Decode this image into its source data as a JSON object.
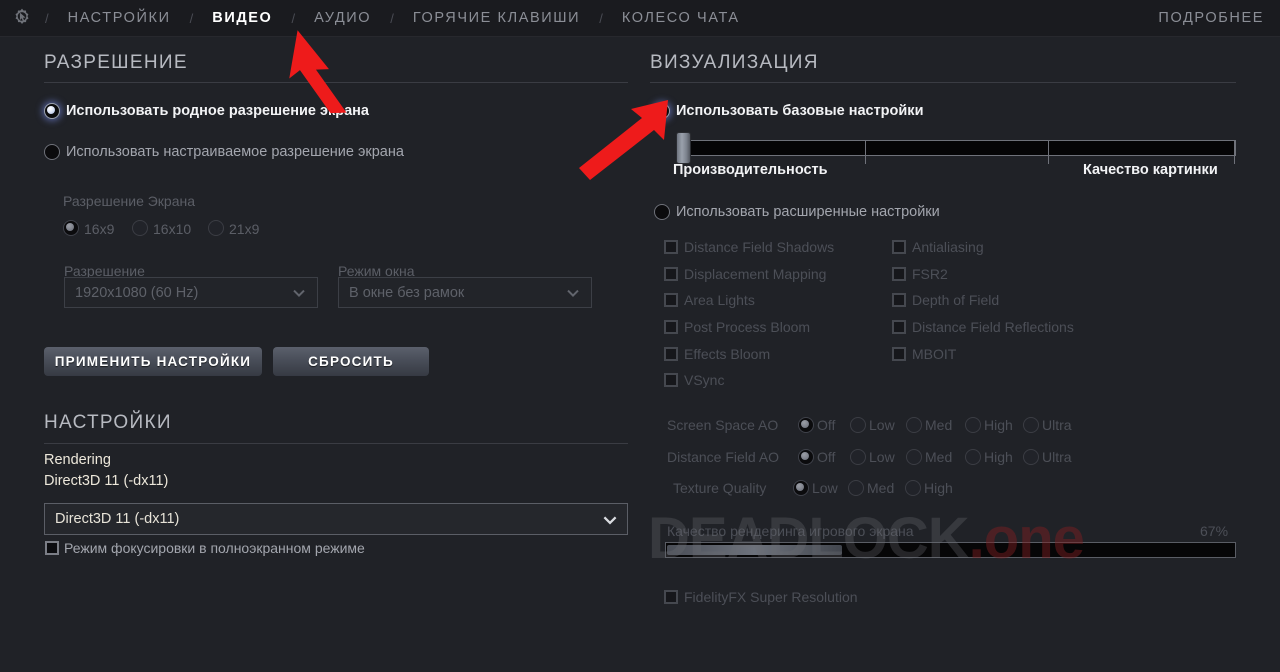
{
  "nav": {
    "gear_icon": "gear-cursor-icon",
    "separator": "/",
    "items": [
      {
        "label": "НАСТРОЙКИ",
        "active": false
      },
      {
        "label": "ВИДЕО",
        "active": true
      },
      {
        "label": "АУДИО",
        "active": false
      },
      {
        "label": "ГОРЯЧИЕ КЛАВИШИ",
        "active": false
      },
      {
        "label": "КОЛЕСО ЧАТА",
        "active": false
      }
    ],
    "more_label": "ПОДРОБНЕЕ"
  },
  "left": {
    "resolution_section": {
      "title": "РАЗРЕШЕНИЕ",
      "radio_native": {
        "label": "Использовать родное разрешение экрана",
        "selected": true
      },
      "radio_custom": {
        "label": "Использовать настраиваемое разрешение экрана",
        "selected": false
      },
      "aspect_label": "Разрешение Экрана",
      "aspect_options": [
        {
          "label": "16x9",
          "selected": true
        },
        {
          "label": "16x10",
          "selected": false
        },
        {
          "label": "21x9",
          "selected": false
        }
      ],
      "resolution_field_label": "Разрешение",
      "resolution_value": "1920x1080 (60 Hz)",
      "window_mode_label": "Режим окна",
      "window_mode_value": "В окне без рамок",
      "apply_button": "ПРИМЕНИТЬ НАСТРОЙКИ",
      "reset_button": "СБРОСИТЬ"
    },
    "settings_section": {
      "title": "НАСТРОЙКИ",
      "rendering_label": "Rendering",
      "rendering_sub": "Direct3D 11 (-dx11)",
      "renderer_value": "Direct3D 11 (-dx11)",
      "focus_mode": {
        "label": "Режим фокусировки в полноэкранном режиме",
        "checked": false
      }
    }
  },
  "right": {
    "visual_section": {
      "title": "ВИЗУАЛИЗАЦИЯ",
      "radio_basic": {
        "label": "Использовать базовые настройки",
        "selected": true
      },
      "quality_slider": {
        "left_label": "Производительность",
        "right_label": "Качество картинки",
        "value_percent": 0,
        "tick_count": 3
      },
      "radio_advanced": {
        "label": "Использовать расширенные настройки",
        "selected": false
      },
      "checkboxes_left": [
        {
          "label": "Distance Field Shadows",
          "checked": false
        },
        {
          "label": "Displacement Mapping",
          "checked": false
        },
        {
          "label": "Area Lights",
          "checked": false
        },
        {
          "label": "Post Process Bloom",
          "checked": false
        },
        {
          "label": "Effects Bloom",
          "checked": false
        },
        {
          "label": "VSync",
          "checked": false
        }
      ],
      "checkboxes_right": [
        {
          "label": "Antialiasing",
          "checked": false
        },
        {
          "label": "FSR2",
          "checked": false
        },
        {
          "label": "Depth of Field",
          "checked": false
        },
        {
          "label": "Distance Field Reflections",
          "checked": false
        },
        {
          "label": "MBOIT",
          "checked": false
        }
      ],
      "quality_rows": [
        {
          "label": "Screen Space AO",
          "options": [
            "Off",
            "Low",
            "Med",
            "High",
            "Ultra"
          ],
          "selected": 0
        },
        {
          "label": "Distance Field AO",
          "options": [
            "Off",
            "Low",
            "Med",
            "High",
            "Ultra"
          ],
          "selected": 0
        },
        {
          "label": "Texture Quality",
          "options": [
            "Low",
            "Med",
            "High"
          ],
          "selected": 0
        }
      ],
      "render_scale": {
        "label": "Качество рендеринга игрового экрана",
        "value": "67%",
        "fill_percent": 31
      },
      "fidelityfx": {
        "label": "FidelityFX Super Resolution",
        "checked": false
      }
    }
  },
  "watermark": {
    "part1": "DEADLOCK",
    "part2": ".one"
  },
  "annotations": {
    "arrow_color": "#ee1b1b",
    "arrow_video_tab": "arrow-pointing-to-video-tab",
    "arrow_basic_radio": "arrow-pointing-to-basic-settings-radio"
  },
  "colors": {
    "background": "#202227",
    "nav_background": "#1a1b1f",
    "text_bright": "#f2f3f5",
    "text_dim": "#5b5e66",
    "accent_red": "#ee1b1b"
  }
}
